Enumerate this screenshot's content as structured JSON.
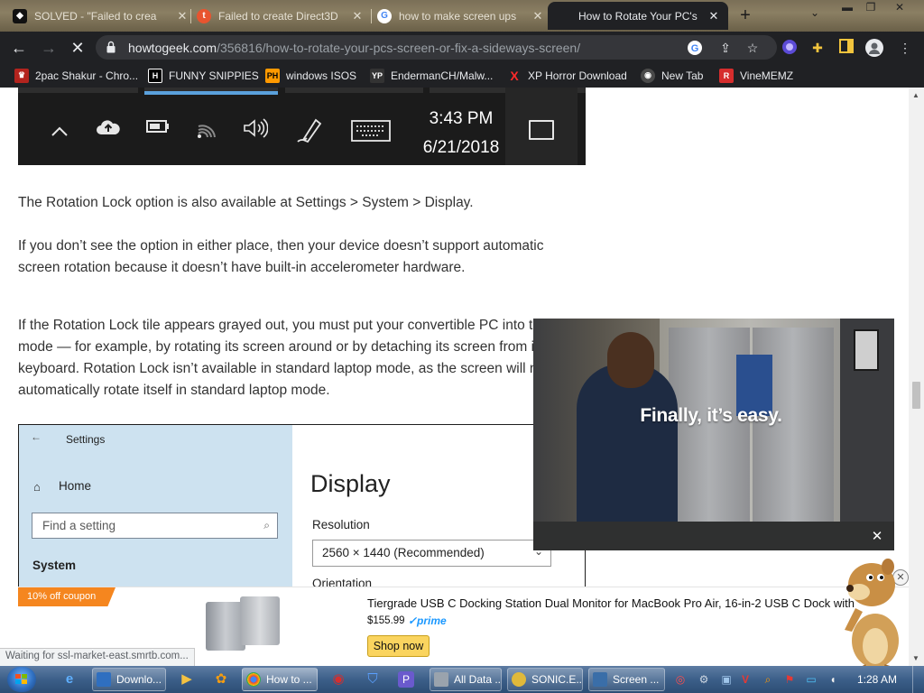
{
  "browser": {
    "tabs": [
      {
        "title": "SOLVED - \"Failed to crea",
        "favicon_color": "#111111",
        "favicon_text": "◆"
      },
      {
        "title": "Failed to create Direct3D",
        "favicon_color": "#e8542f",
        "favicon_text": "t"
      },
      {
        "title": "how to make screen ups",
        "favicon_color": "#ffffff",
        "favicon_text": "G"
      },
      {
        "title": "How to Rotate Your PC's",
        "favicon_color": "#202124",
        "favicon_text": ""
      }
    ],
    "new_tab_label": "+",
    "url_host": "howtogeek.com",
    "url_path": "/356816/how-to-rotate-your-pcs-screen-or-fix-a-sideways-screen/",
    "bookmarks": [
      {
        "label": "2pac Shakur - Chro...",
        "icon_color": "#b3241e",
        "icon_text": "♛"
      },
      {
        "label": "FUNNY SNIPPIES",
        "icon_color": "#000000",
        "icon_text": "H"
      },
      {
        "label": "windows ISOS",
        "icon_color": "#ff9900",
        "icon_text": "PH"
      },
      {
        "label": "EndermanCH/Malw...",
        "icon_color": "#333333",
        "icon_text": "YP"
      },
      {
        "label": "XP Horror Download",
        "icon_color": "#202124",
        "icon_text": "X"
      },
      {
        "label": "New Tab",
        "icon_color": "#4a4a4a",
        "icon_text": "◉"
      },
      {
        "label": "VineMEMZ",
        "icon_color": "#d62d2d",
        "icon_text": "R"
      }
    ]
  },
  "article": {
    "taskbar_figure": {
      "time": "3:43 PM",
      "date": "6/21/2018"
    },
    "paragraphs": [
      "The Rotation Lock option is also available at Settings > System > Display.",
      "If you don’t see the option in either place, then your device doesn’t support automatic screen rotation because it doesn’t have built-in accelerometer hardware.",
      "If the Rotation Lock tile appears grayed out, you must put your convertible PC into tablet mode — for example, by rotating its screen around or by detaching its screen from its keyboard. Rotation Lock isn’t available in standard laptop mode, as the screen will never automatically rotate itself in standard laptop mode."
    ],
    "settings_figure": {
      "window_title": "Settings",
      "home": "Home",
      "search_placeholder": "Find a setting",
      "section": "System",
      "page_title": "Display",
      "resolution_label": "Resolution",
      "resolution_value": "2560 × 1440 (Recommended)",
      "orientation_label": "Orientation"
    }
  },
  "video_ad": {
    "tagline": "Finally, it’s easy.",
    "close": "✕"
  },
  "product_ad": {
    "coupon": "10% off coupon",
    "title": "Tiergrade USB C Docking Station Dual Monitor for MacBook Pro Air, 16-in-2 USB C Dock with",
    "price": "$155.99",
    "prime": "✓prime",
    "shop_now": "Shop now",
    "close": "✕"
  },
  "status_text": "Waiting for ssl-market-east.smrtb.com...",
  "taskbar": {
    "apps": [
      {
        "label": "Downlo...",
        "icon_color": "#2f6fc0"
      },
      {
        "label": "How to ...",
        "icon_color": "#e24a3c"
      },
      {
        "label": "All Data ...",
        "icon_color": "#9aa3ad"
      },
      {
        "label": "SONIC.E...",
        "icon_color": "#e0b93a"
      },
      {
        "label": "Screen ...",
        "icon_color": "#3a6ea8"
      }
    ],
    "clock": "1:28 AM"
  }
}
